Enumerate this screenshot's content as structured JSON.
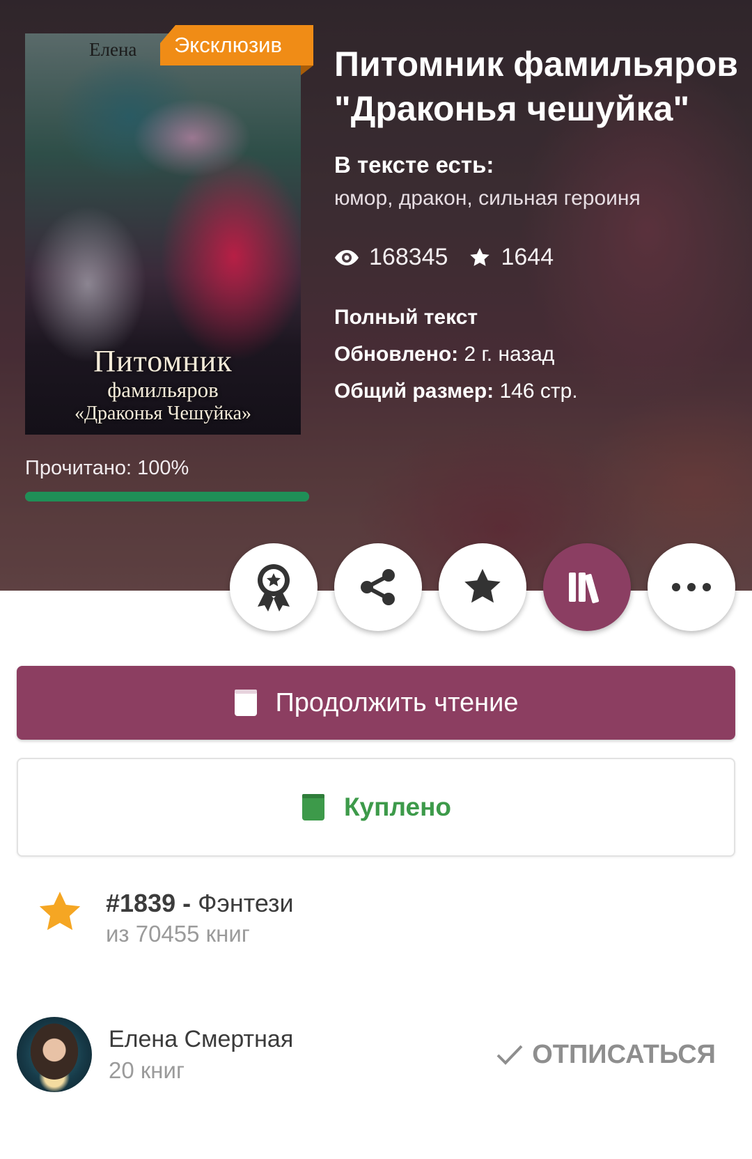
{
  "cover": {
    "badge": "Эксклюзив",
    "author_on_cover": "Елена",
    "title_line1": "Питомник",
    "title_line2": "фамильяров",
    "title_line3": "«Драконья Чешуйка»"
  },
  "progress": {
    "label": "Прочитано: 100%",
    "value": 100
  },
  "book": {
    "title": "Питомник фамильяров \"Драконья чешуйка\"",
    "tags_heading": "В тексте есть:",
    "tags": "юмор, дракон, сильная героиня",
    "views": "168345",
    "likes": "1644",
    "status": "Полный текст",
    "updated_label": "Обновлено:",
    "updated_value": "2 г. назад",
    "size_label": "Общий размер:",
    "size_value": "146 стр."
  },
  "actions": [
    {
      "name": "award-button",
      "icon": "award-icon"
    },
    {
      "name": "share-button",
      "icon": "share-icon"
    },
    {
      "name": "favorite-button",
      "icon": "star-icon"
    },
    {
      "name": "library-button",
      "icon": "library-icon",
      "active": true
    },
    {
      "name": "more-button",
      "icon": "more-icon"
    }
  ],
  "buttons": {
    "continue_reading": "Продолжить чтение",
    "bought": "Куплено"
  },
  "rank": {
    "number": "#1839",
    "separator": " - ",
    "genre": "Фэнтези",
    "of_total": "из 70455 книг"
  },
  "author": {
    "name": "Елена Смертная",
    "books_count": "20 книг",
    "unsubscribe_label": "ОТПИСАТЬСЯ"
  },
  "colors": {
    "accent": "#8c3e61",
    "badge": "#f08c16",
    "progress": "#1f8f57",
    "bought": "#3d9a4a",
    "rank_star": "#f5a623"
  }
}
